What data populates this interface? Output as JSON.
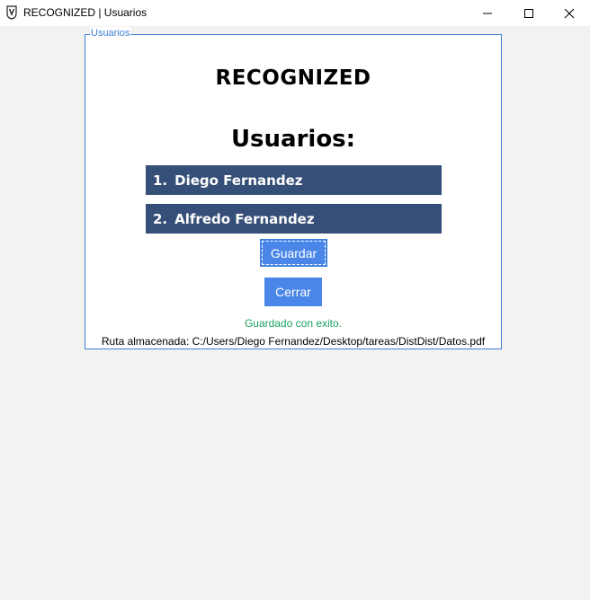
{
  "window": {
    "title": "RECOGNIZED | Usuarios",
    "icon": "app-logo-icon",
    "controls": [
      "minimize-icon",
      "maximize-icon",
      "close-icon"
    ]
  },
  "groupbox": {
    "label": "Usuarios"
  },
  "main": {
    "brand": "RECOGNIZED",
    "section_title": "Usuarios:",
    "users": [
      {
        "number": "1.",
        "name": "Diego Fernandez"
      },
      {
        "number": "2.",
        "name": "Alfredo Fernandez"
      }
    ],
    "save_label": "Guardar",
    "close_label": "Cerrar",
    "status": "Guardado con exito.",
    "path": "Ruta almacenada: C:/Users/Diego Fernandez/Desktop/tareas/DistDist/Datos.pdf"
  },
  "colors": {
    "row_bg": "#364f78",
    "button_bg": "#4a86e8",
    "status_text": "#1aa260",
    "frame_border": "#3f7fd6",
    "background": "#f2f2f0"
  }
}
